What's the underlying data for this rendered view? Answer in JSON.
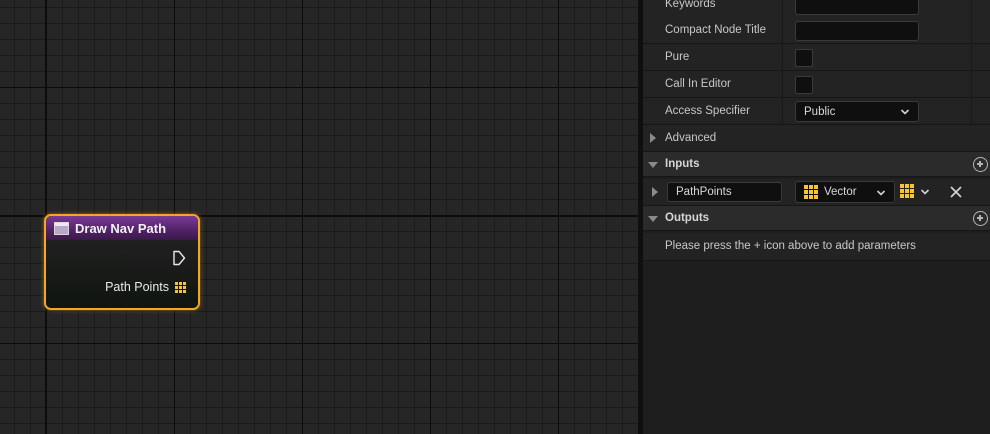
{
  "node": {
    "title": "Draw Nav Path",
    "pin_label": "Path Points",
    "header_color": "#6b2f86",
    "border_color": "#f5a623",
    "pin_color": "#f7c531"
  },
  "details": {
    "rows": [
      {
        "label": "Keywords",
        "kind": "text",
        "value": ""
      },
      {
        "label": "Compact Node Title",
        "kind": "text",
        "value": ""
      },
      {
        "label": "Pure",
        "kind": "checkbox",
        "checked": false
      },
      {
        "label": "Call In Editor",
        "kind": "checkbox",
        "checked": false
      },
      {
        "label": "Access Specifier",
        "kind": "dropdown",
        "value": "Public"
      }
    ],
    "advanced_label": "Advanced",
    "inputs_label": "Inputs",
    "input_param": {
      "name": "PathPoints",
      "type": "Vector",
      "type_icon": "grid-array-icon"
    },
    "outputs_label": "Outputs",
    "outputs_hint": "Please press the + icon above to add parameters"
  }
}
